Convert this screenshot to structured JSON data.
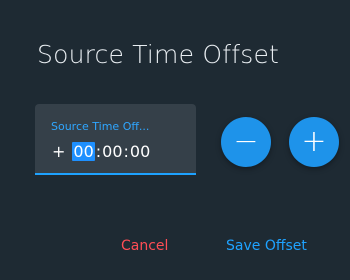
{
  "dialog": {
    "title": "Source Time Offset"
  },
  "offset_field": {
    "label": "Source Time Off...",
    "sign": "+",
    "hours": "00",
    "minutes": "00",
    "seconds": "00",
    "separator": ":"
  },
  "stepper": {
    "decrement_glyph": "−",
    "increment_glyph": "+"
  },
  "actions": {
    "cancel_label": "Cancel",
    "save_label": "Save Offset"
  },
  "colors": {
    "background": "#1e2a33",
    "accent": "#1ea2ff",
    "danger": "#ff4d55"
  }
}
